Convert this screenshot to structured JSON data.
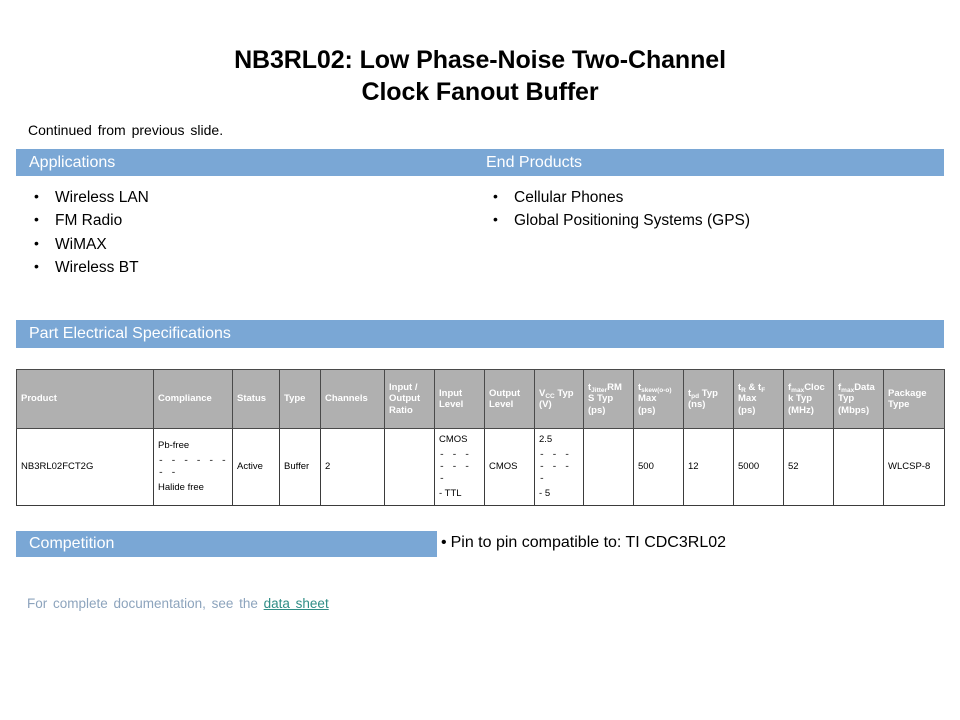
{
  "slide": {
    "title_line1": "NB3RL02: Low Phase-Noise Two-Channel",
    "title_line2": "Clock Fanout Buffer",
    "continued_note": "Continued  from previous slide."
  },
  "sections": {
    "applications_label": "Applications",
    "end_products_label": "End Products",
    "spec_label": "Part Electrical Specifications",
    "competition_label": "Competition"
  },
  "applications": [
    "Wireless LAN",
    "FM Radio",
    "WiMAX",
    "Wireless BT"
  ],
  "end_products": [
    "Cellular Phones",
    "Global Positioning Systems (GPS)"
  ],
  "table": {
    "headers": [
      {
        "main": "Product",
        "sub": "",
        "after": "",
        "line2": "",
        "line3": ""
      },
      {
        "main": "Compliance",
        "sub": "",
        "after": "",
        "line2": "",
        "line3": ""
      },
      {
        "main": "Status",
        "sub": "",
        "after": "",
        "line2": "",
        "line3": ""
      },
      {
        "main": "Type",
        "sub": "",
        "after": "",
        "line2": "",
        "line3": ""
      },
      {
        "main": "Channels",
        "sub": "",
        "after": "",
        "line2": "",
        "line3": ""
      },
      {
        "main": "Input /",
        "sub": "",
        "after": "",
        "line2": "Output",
        "line3": "Ratio"
      },
      {
        "main": "Input",
        "sub": "",
        "after": "",
        "line2": "Level",
        "line3": ""
      },
      {
        "main": "Output",
        "sub": "",
        "after": "",
        "line2": "Level",
        "line3": ""
      },
      {
        "main": "V",
        "sub": "CC",
        "after": " Typ",
        "line2": "(V)",
        "line3": ""
      },
      {
        "main": "t",
        "sub": "Jitter",
        "after": "RM",
        "line2": "S Typ",
        "line3": "(ps)"
      },
      {
        "main": "t",
        "sub": "skew(o-o)",
        "after": "",
        "line2": "Max",
        "line3": "(ps)"
      },
      {
        "main": "t",
        "sub": "pd",
        "after": " Typ",
        "line2": "(ns)",
        "line3": ""
      },
      {
        "main": "t",
        "sub": "R",
        "after": " & t",
        "sub2": "F",
        "line2": "Max",
        "line3": "(ps)"
      },
      {
        "main": "f",
        "sub": "max",
        "after": "Cloc",
        "line2": "k Typ",
        "line3": "(MHz)"
      },
      {
        "main": "f",
        "sub": "max",
        "after": "Data",
        "line2": "Typ",
        "line3": "(Mbps)"
      },
      {
        "main": "Package",
        "sub": "",
        "after": "",
        "line2": "Type",
        "line3": ""
      }
    ],
    "rows": [
      {
        "product": "NB3RL02FCT2G",
        "compliance_top": "Pb-free",
        "compliance_sep": "- - - - - - - -",
        "compliance_bottom": "Halide  free",
        "status": "Active",
        "type": "Buffer",
        "channels": "2",
        "io_ratio": "",
        "input_level_top": "CMOS",
        "input_level_sep": "- - - - - - -",
        "input_level_dash": "-",
        "input_level_bottom": "TTL",
        "output_level": "CMOS",
        "vcc_top": "2.5",
        "vcc_sep": "- - - - - - -",
        "vcc_dash": "-",
        "vcc_bottom": "5",
        "tjitter": "",
        "tskew": "500",
        "tpd": "12",
        "trtf": "5000",
        "fmax_clock": "52",
        "fmax_data": "",
        "package": "WLCSP-8"
      }
    ]
  },
  "competition": {
    "bullet": "•",
    "text": "Pin to pin compatible to:  TI  CDC3RL02"
  },
  "footer": {
    "prefix": "For complete documentation,  see the ",
    "link_text": "data sheet"
  },
  "colors": {
    "bar_blue": "#7aa7d5",
    "table_header_gray": "#b0b0b0",
    "link_teal": "#2f8d86",
    "footer_gray": "#8da4bd"
  }
}
